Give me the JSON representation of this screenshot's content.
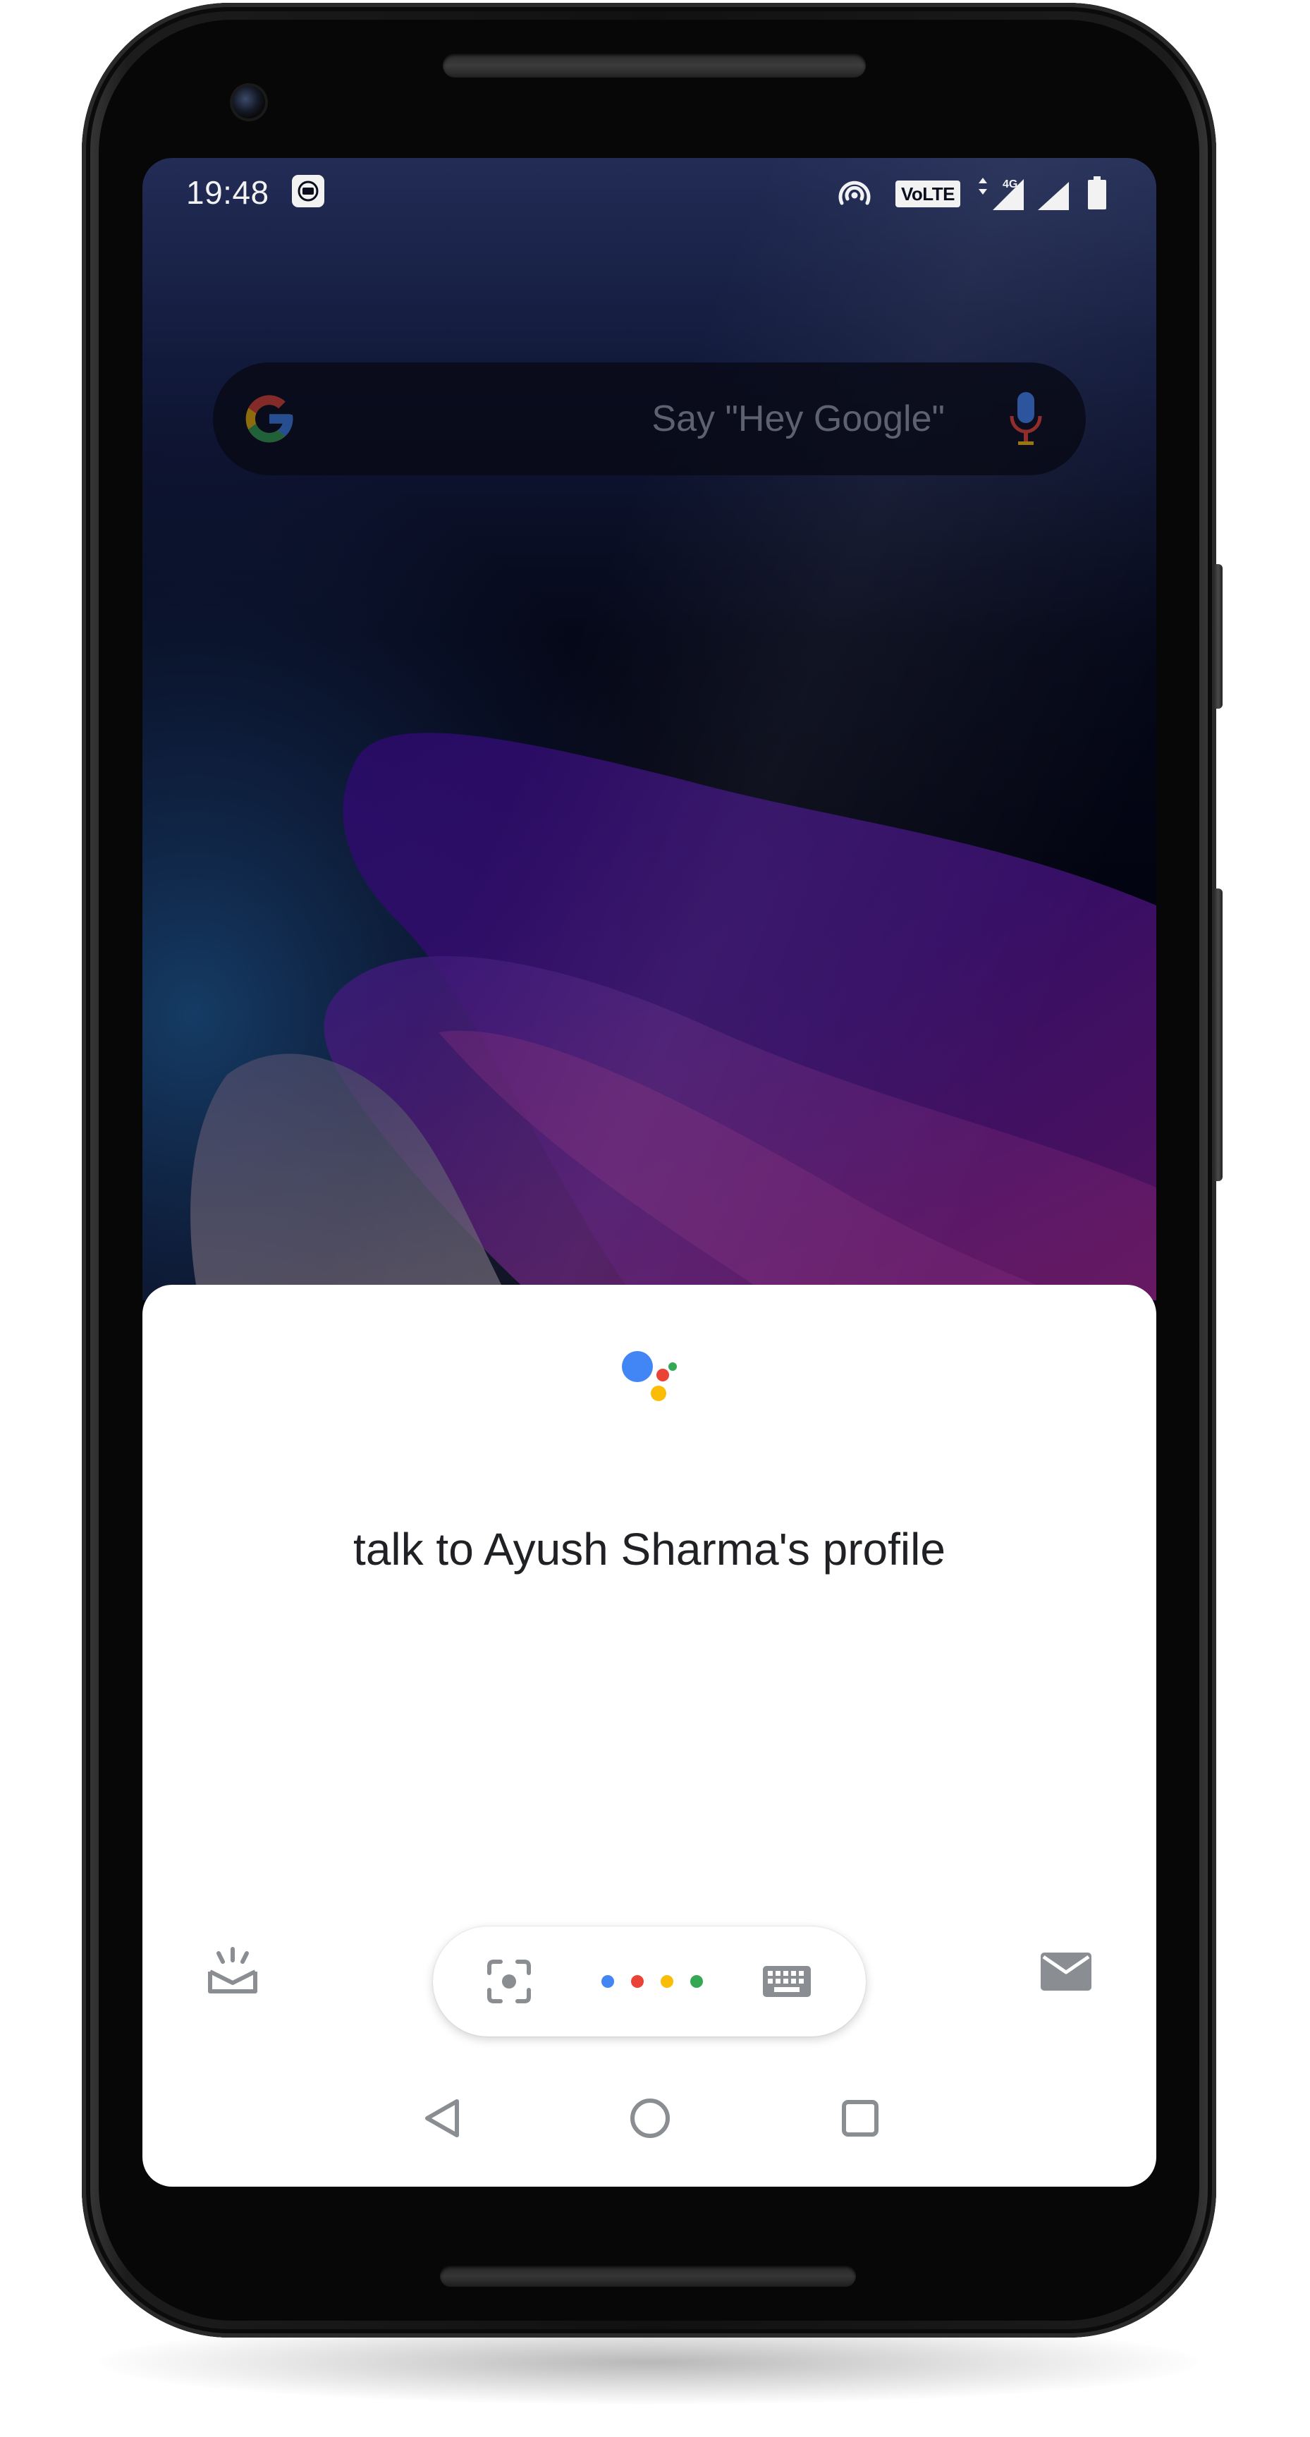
{
  "status_bar": {
    "time": "19:48",
    "volte_label": "VoLTE",
    "network_label": "4G"
  },
  "search_bar": {
    "hint": "Say \"Hey Google\""
  },
  "assistant": {
    "query": "talk to Ayush Sharma's profile"
  },
  "icons": {
    "left_action": "explore-icon",
    "right_action": "mail-icon",
    "pill_left": "lens-icon",
    "pill_right": "keyboard-icon",
    "nav": [
      "back-icon",
      "home-icon",
      "recents-icon"
    ]
  },
  "colors": {
    "google_blue": "#4285F4",
    "google_red": "#EA4335",
    "google_yellow": "#FBBC05",
    "google_green": "#34A853",
    "icon_gray": "#8a8d91",
    "text_dark": "#202124"
  }
}
